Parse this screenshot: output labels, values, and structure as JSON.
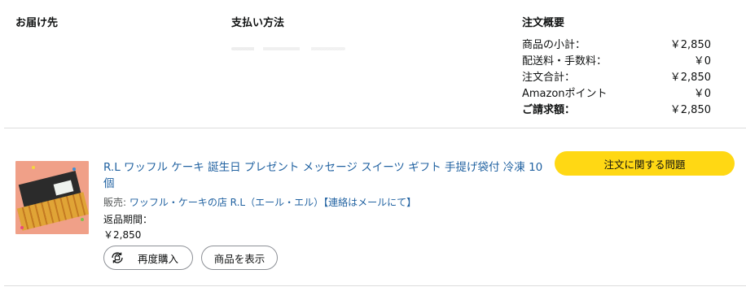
{
  "shipping": {
    "title": "お届け先"
  },
  "payment": {
    "title": "支払い方法"
  },
  "summary": {
    "title": "注文概要",
    "rows": [
      {
        "label": "商品の小計：",
        "value": "￥2,850"
      },
      {
        "label": "配送料・手数料：",
        "value": "￥0"
      },
      {
        "label": "注文合計：",
        "value": "￥2,850"
      },
      {
        "label": "Amazonポイント",
        "value": "￥0"
      },
      {
        "label": "ご請求額：",
        "value": "￥2,850"
      }
    ]
  },
  "item": {
    "title": "R.L ワッフル ケーキ 誕生日 プレゼント メッセージ スイーツ ギフト 手提げ袋付 冷凍 10個",
    "seller_prefix": "販売: ",
    "seller_name": "ワッフル・ケーキの店 R.L（エール・エル）【連絡はメールにて】",
    "return_period": "返品期間：",
    "price": "￥2,850",
    "buy_again_label": "再度購入",
    "view_item_label": "商品を表示"
  },
  "actions": {
    "problem_label": "注文に関する問題"
  },
  "colors": {
    "accent_yellow": "#ffd814",
    "link_blue": "#2162a1",
    "thumbnail_bg": "#f0a088"
  },
  "icons": {
    "buy_again": "cart-refresh-icon"
  }
}
